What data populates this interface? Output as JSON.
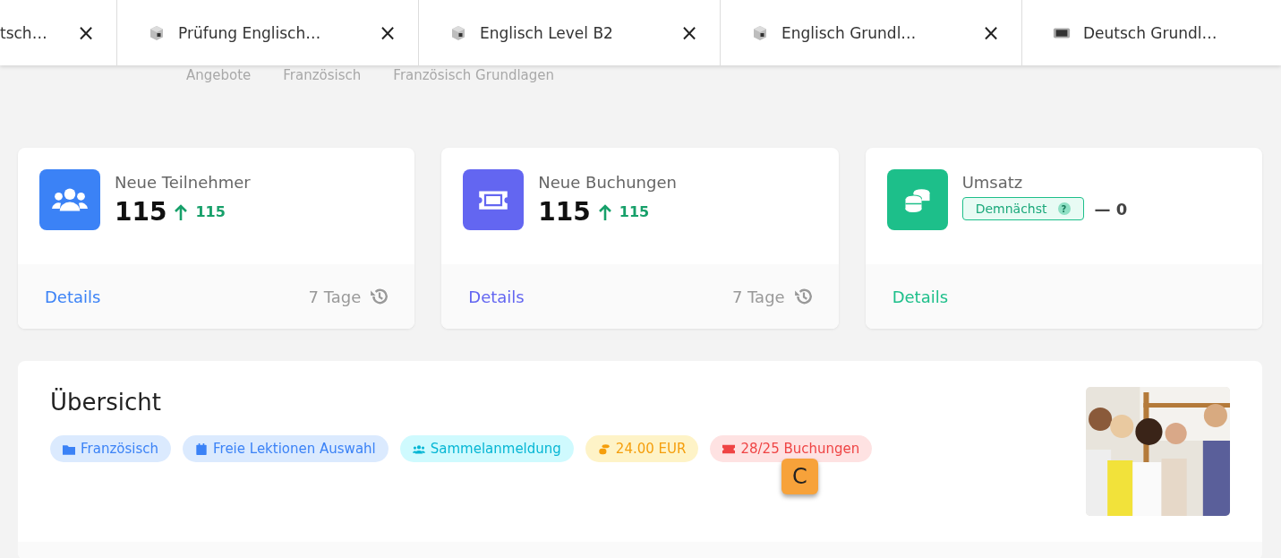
{
  "tabs": [
    {
      "label": "tsch…",
      "kind": "plain",
      "close": "×"
    },
    {
      "label": "Prüfung Englisch…",
      "kind": "cube",
      "close": "×"
    },
    {
      "label": "Englisch Level B2",
      "kind": "cube",
      "close": "×"
    },
    {
      "label": "Englisch Grundl…",
      "kind": "cube",
      "close": "×"
    },
    {
      "label": "Deutsch Grundl…",
      "kind": "chip"
    }
  ],
  "breadcrumb": [
    "Angebote",
    "Französisch",
    "Französisch Grundlagen"
  ],
  "stats": [
    {
      "kind": "people",
      "color": "#3b82f6",
      "title": "Neue Teilnehmer",
      "value": "115",
      "change": "115",
      "link": "Details",
      "period": "7 Tage"
    },
    {
      "kind": "ticket",
      "color": "#6366f1",
      "title": "Neue Buchungen",
      "value": "115",
      "change": "115",
      "link": "Details",
      "period": "7 Tage"
    },
    {
      "kind": "coins",
      "color": "#1dbf8a",
      "title": "Umsatz",
      "badge": "Demnächst",
      "help": "?",
      "value": "— 0",
      "link": "Details"
    }
  ],
  "overview": {
    "title": "Übersicht",
    "tags": [
      {
        "kind": "folder",
        "label": "Französisch",
        "color": "#3b82f6"
      },
      {
        "kind": "calendar",
        "label": "Freie Lektionen Auswahl",
        "color": "#3b82f6"
      },
      {
        "kind": "people",
        "label": "Sammelanmeldung",
        "color": "#06b6d4"
      },
      {
        "kind": "coins",
        "label": "24.00 EUR",
        "color": "#f59e0b"
      },
      {
        "kind": "ticket",
        "label": "28/25 Buchungen",
        "color": "#ef4444"
      }
    ],
    "hint_badge": "C"
  }
}
